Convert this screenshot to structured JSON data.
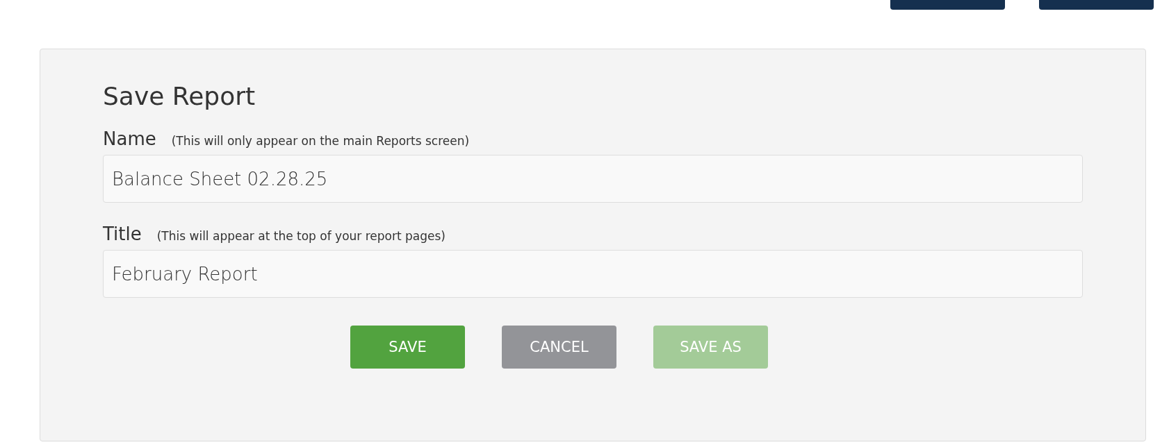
{
  "top_buttons": [
    {
      "kind": "nav"
    },
    {
      "kind": "nav"
    }
  ],
  "dialog": {
    "title": "Save Report",
    "fields": [
      {
        "label": "Name",
        "hint": "(This will only appear on the main Reports screen)",
        "value": "Balance Sheet 02.28.25"
      },
      {
        "label": "Title",
        "hint": "(This will appear at the top of your report pages)",
        "value": "February Report"
      }
    ],
    "buttons": [
      {
        "label": "SAVE",
        "kind": "primary",
        "disabled": false
      },
      {
        "label": "CANCEL",
        "kind": "secondary",
        "disabled": false
      },
      {
        "label": "SAVE AS",
        "kind": "primary",
        "disabled": true
      }
    ]
  }
}
